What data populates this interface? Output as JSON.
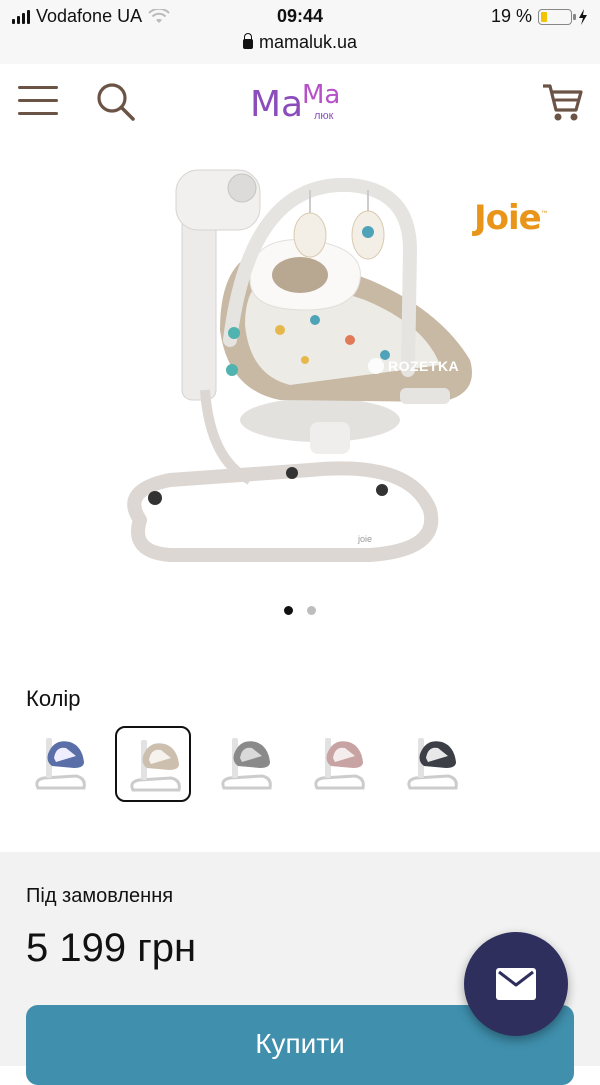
{
  "status_bar": {
    "carrier": "Vodafone UA",
    "time": "09:44",
    "url": "mamaluk.ua",
    "battery": "19 %"
  },
  "header": {
    "icons": [
      "menu-icon",
      "search-icon",
      "cart-icon"
    ],
    "logo_text_ma1": "Ma",
    "logo_text_ma2": "Ma",
    "logo_subtext": "люк"
  },
  "product": {
    "brand": "Joie",
    "watermark": "ROZETKA",
    "carousel_pages": 2,
    "carousel_active": 1
  },
  "color": {
    "label": "Колір",
    "options": [
      {
        "name": "blue",
        "accent": "#5a6ea8"
      },
      {
        "name": "beige",
        "accent": "#cdbfae",
        "selected": true
      },
      {
        "name": "grey",
        "accent": "#8a8a8a"
      },
      {
        "name": "pink",
        "accent": "#c8a3a3"
      },
      {
        "name": "dark",
        "accent": "#3c3f46"
      }
    ]
  },
  "purchase": {
    "availability": "Під замовлення",
    "price": "5 199 грн",
    "buy_label": "Купити"
  },
  "colors": {
    "accent_button": "#3f8fad",
    "chat_button": "#2f2f5e",
    "logo_purple": "#8a4dbb",
    "logo_violet": "#b64fc9",
    "brand_orange": "#e8951a"
  }
}
